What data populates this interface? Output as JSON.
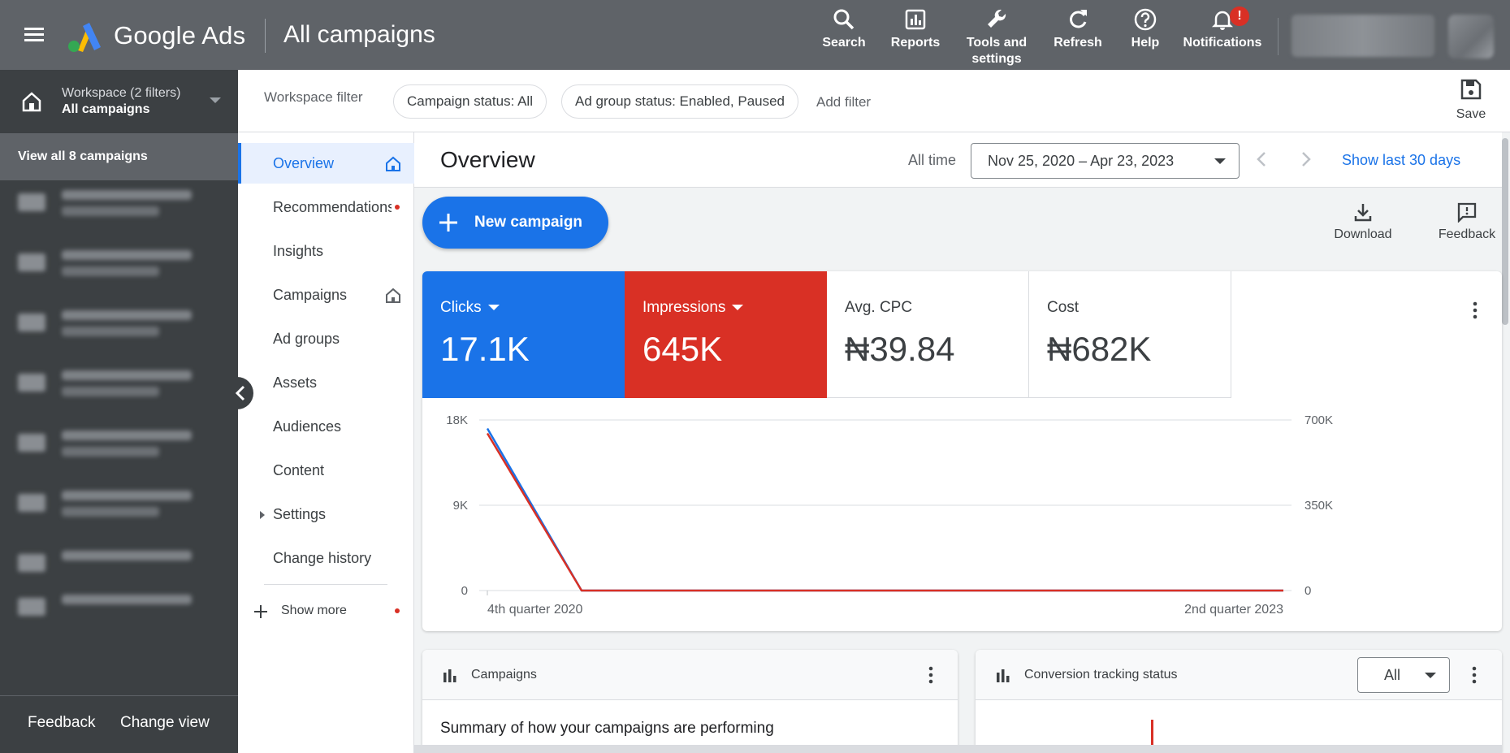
{
  "app": {
    "brand": "Google Ads",
    "page_title": "All campaigns"
  },
  "topbar": {
    "tools": [
      {
        "label": "Search",
        "icon": "search-icon"
      },
      {
        "label": "Reports",
        "icon": "reports-icon"
      },
      {
        "label": "Tools and settings",
        "icon": "wrench-icon"
      },
      {
        "label": "Refresh",
        "icon": "refresh-icon"
      },
      {
        "label": "Help",
        "icon": "help-icon"
      },
      {
        "label": "Notifications",
        "icon": "bell-icon"
      }
    ],
    "notification_badge": "!"
  },
  "workspace": {
    "line1": "Workspace (2 filters)",
    "line2": "All campaigns",
    "view_all": "View all 8 campaigns"
  },
  "left_footer": {
    "feedback": "Feedback",
    "change_view": "Change view"
  },
  "filters": {
    "label": "Workspace filter",
    "chips": [
      "Campaign status: All",
      "Ad group status: Enabled, Paused"
    ],
    "add_filter": "Add filter",
    "save": "Save"
  },
  "nav": {
    "items": [
      "Overview",
      "Recommendations",
      "Insights",
      "Campaigns",
      "Ad groups",
      "Assets",
      "Audiences",
      "Content",
      "Settings",
      "Change history"
    ],
    "show_more": "Show more"
  },
  "overview": {
    "title": "Overview",
    "range_label": "All time",
    "date_range": "Nov 25, 2020 – Apr 23, 2023",
    "show_last": "Show last 30 days",
    "new_campaign": "New campaign",
    "download": "Download",
    "feedback": "Feedback"
  },
  "scorecards": [
    {
      "label": "Clicks",
      "value": "17.1K",
      "color": "#1a73e8"
    },
    {
      "label": "Impressions",
      "value": "645K",
      "color": "#d93025"
    },
    {
      "label": "Avg. CPC",
      "value": "₦39.84"
    },
    {
      "label": "Cost",
      "value": "₦682K"
    }
  ],
  "chart_data": {
    "type": "line",
    "x_labels": [
      "4th quarter 2020",
      "2nd quarter 2023"
    ],
    "x": [
      0,
      1,
      2,
      3,
      4,
      5,
      6,
      7,
      8,
      9,
      10
    ],
    "left_axis": {
      "ticks": [
        "0",
        "9K",
        "18K"
      ],
      "ylim": [
        0,
        18000
      ]
    },
    "right_axis": {
      "ticks": [
        "0",
        "350K",
        "700K"
      ],
      "ylim": [
        0,
        700000
      ]
    },
    "series": [
      {
        "name": "Clicks",
        "color": "#1a73e8",
        "axis": "left",
        "values": [
          17100,
          0,
          0,
          0,
          0,
          0,
          0,
          0,
          0,
          0,
          0
        ]
      },
      {
        "name": "Impressions",
        "color": "#d93025",
        "axis": "right",
        "values": [
          645000,
          0,
          0,
          0,
          0,
          0,
          0,
          0,
          0,
          0,
          0
        ]
      }
    ],
    "grid": true
  },
  "cards": {
    "campaigns": {
      "title": "Campaigns",
      "summary": "Summary of how your campaigns are performing"
    },
    "conversion": {
      "title": "Conversion tracking status",
      "filter": "All"
    }
  }
}
